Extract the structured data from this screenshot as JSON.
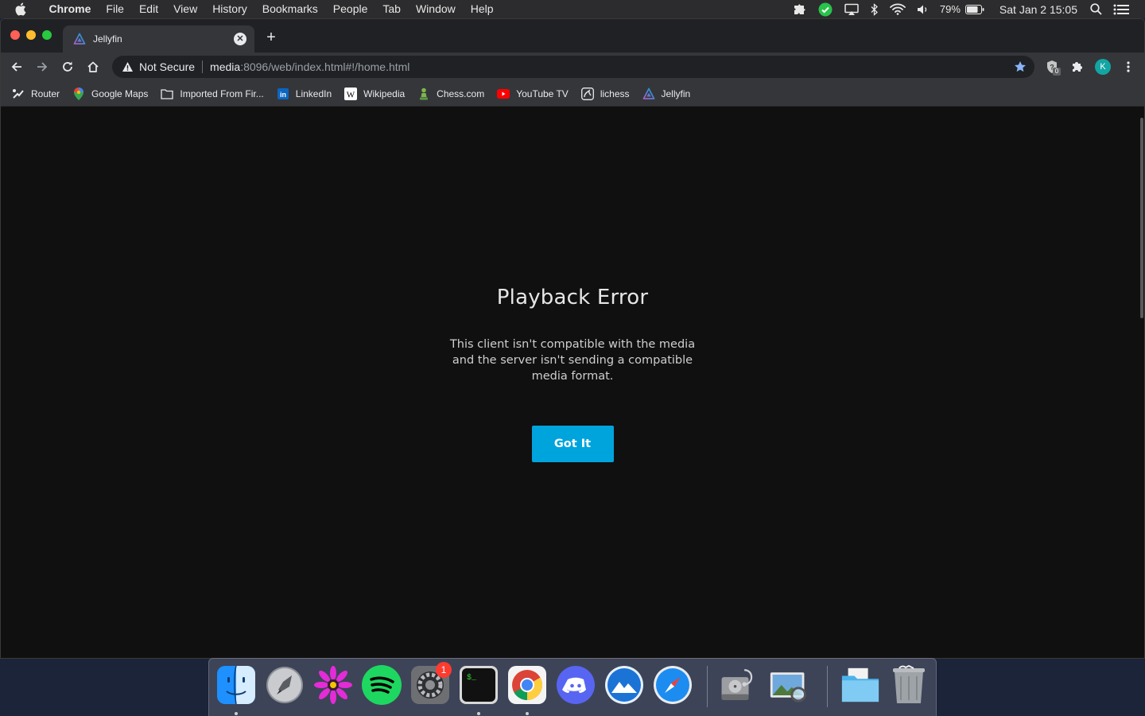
{
  "menubar": {
    "app": "Chrome",
    "items": [
      "File",
      "Edit",
      "View",
      "History",
      "Bookmarks",
      "People",
      "Tab",
      "Window",
      "Help"
    ],
    "battery": "79%",
    "datetime": "Sat Jan 2  15:05"
  },
  "browser": {
    "tab_title": "Jellyfin",
    "security_label": "Not Secure",
    "url_host": "media",
    "url_rest": ":8096/web/index.html#!/home.html",
    "profile_initial": "K",
    "extension_badge": "0"
  },
  "bookmarks": [
    {
      "label": "Router",
      "icon": "router-icon"
    },
    {
      "label": "Google Maps",
      "icon": "google-maps-icon"
    },
    {
      "label": "Imported From Fir...",
      "icon": "folder-icon"
    },
    {
      "label": "LinkedIn",
      "icon": "linkedin-icon"
    },
    {
      "label": "Wikipedia",
      "icon": "wikipedia-icon"
    },
    {
      "label": "Chess.com",
      "icon": "chess-pawn-icon"
    },
    {
      "label": "YouTube TV",
      "icon": "youtube-icon"
    },
    {
      "label": "lichess",
      "icon": "lichess-icon"
    },
    {
      "label": "Jellyfin",
      "icon": "jellyfin-icon"
    }
  ],
  "dialog": {
    "title": "Playback Error",
    "message": "This client isn't compatible with the media and the server isn't sending a compatible media format.",
    "button": "Got It"
  },
  "dock": {
    "apps": [
      "Finder",
      "Launchpad",
      "Flower",
      "Spotify",
      "System Preferences",
      "Terminal",
      "Google Chrome",
      "Discord",
      "Mountain",
      "Safari",
      "Disk Utility",
      "Preview",
      "Downloads Folder",
      "Trash"
    ],
    "system_prefs_badge": "1"
  },
  "colors": {
    "accent": "#00a4dc",
    "content_bg": "#101010",
    "chrome_toolbar": "#35363a"
  }
}
